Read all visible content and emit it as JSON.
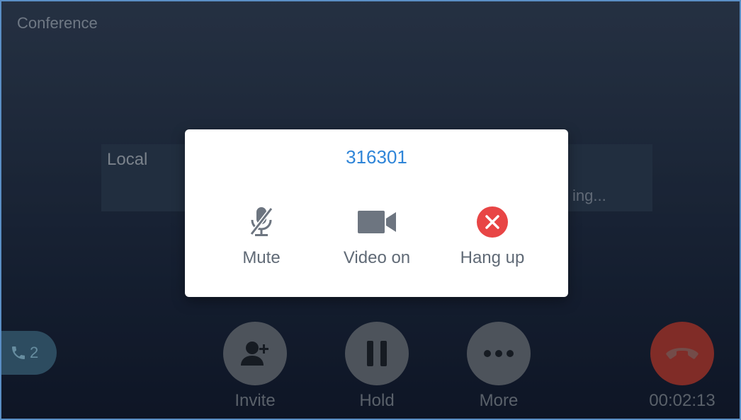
{
  "screen": {
    "title": "Conference"
  },
  "participants": {
    "left": {
      "label": "Local",
      "status": ""
    },
    "right": {
      "label": "",
      "status": "ing..."
    }
  },
  "dialog": {
    "number": "316301",
    "actions": [
      {
        "label": "Mute",
        "icon": "mic-off-icon"
      },
      {
        "label": "Video on",
        "icon": "video-camera-icon"
      },
      {
        "label": "Hang up",
        "icon": "close-circle-icon",
        "color": "#e84545"
      }
    ]
  },
  "lines_badge": {
    "count": "2",
    "icon": "phone-icon"
  },
  "controls": {
    "invite": {
      "label": "Invite",
      "icon": "add-person-icon"
    },
    "hold": {
      "label": "Hold",
      "icon": "pause-icon"
    },
    "more": {
      "label": "More",
      "icon": "ellipsis-icon"
    },
    "end": {
      "label": "00:02:13",
      "icon": "hang-up-icon"
    }
  },
  "colors": {
    "accent": "#2f85d8",
    "danger": "#e84545",
    "end_call": "#b23d36"
  }
}
